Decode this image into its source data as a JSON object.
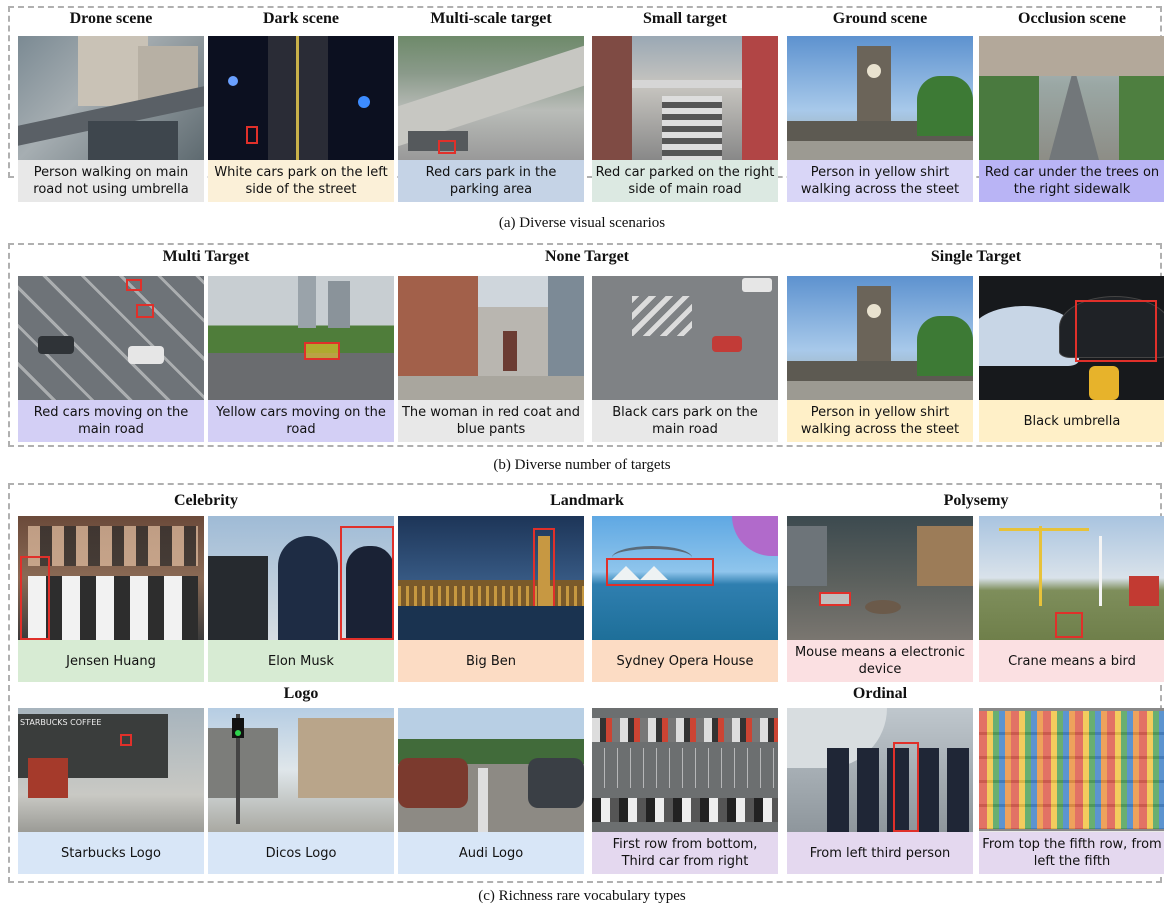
{
  "colors": {
    "gray": "#e8e8e8",
    "cream": "#fbf0d8",
    "steel": "#c5d3e6",
    "mint": "#dce9e2",
    "lavender": "#d9d6f7",
    "violet": "#b9b4f5",
    "lilac": "#d3cff5",
    "sand": "#fff0c8",
    "green": "#d7ebd3",
    "peach": "#fcdcc4",
    "pink": "#fbe0e2",
    "blue": "#d8e6f7",
    "purple": "#e4d8ef",
    "bbox": "#e0302a"
  },
  "sections": [
    {
      "caption": "(a) Diverse visual scenarios",
      "headings": [
        "Drone scene",
        "Dark scene",
        "Multi-scale target",
        "Small target",
        "Ground scene",
        "Occlusion scene"
      ],
      "cards": [
        {
          "label": "Person walking on main road not using umbrella",
          "scene": "aerial-city"
        },
        {
          "label": "White cars park on the left side of the street",
          "scene": "night-road"
        },
        {
          "label": "Red cars park in the parking area",
          "scene": "parking"
        },
        {
          "label": "Red car parked on the right side of main road",
          "scene": "busy-street"
        },
        {
          "label": "Person in yellow shirt walking across the steet",
          "scene": "clocktower"
        },
        {
          "label": "Red car under the trees on the right sidewalk",
          "scene": "avenue"
        }
      ]
    },
    {
      "caption": "(b) Diverse number of targets",
      "headings": [
        "Multi Target",
        "None Target",
        "Single Target"
      ],
      "cards": [
        {
          "label": "Red cars moving on the main road",
          "scene": "aerial-cars"
        },
        {
          "label": "Yellow cars moving on the road",
          "scene": "highway"
        },
        {
          "label": "The woman in red coat and blue pants",
          "scene": "brick-street"
        },
        {
          "label": "Black cars park on the main road",
          "scene": "crossing"
        },
        {
          "label": "Person in yellow shirt walking across the steet",
          "scene": "clocktower"
        },
        {
          "label": "Black umbrella",
          "scene": "umbrella"
        }
      ]
    },
    {
      "caption": "(c) Richness rare vocabulary types",
      "headings_row1": [
        "Celebrity",
        "Landmark",
        "Polysemy"
      ],
      "headings_row2": [
        "Logo",
        "Ordinal"
      ],
      "cards_row1": [
        {
          "label": "Jensen Huang",
          "scene": "crowd"
        },
        {
          "label": "Elon Musk",
          "scene": "suits"
        },
        {
          "label": "Big Ben",
          "scene": "parliament"
        },
        {
          "label": "Sydney Opera House",
          "scene": "opera"
        },
        {
          "label": "Mouse means a electronic device",
          "scene": "warehouse"
        },
        {
          "label": "Crane means a bird",
          "scene": "cranes"
        }
      ],
      "cards_row2": [
        {
          "label": "Starbucks Logo",
          "scene": "storefront"
        },
        {
          "label": "Dicos Logo",
          "scene": "plaza"
        },
        {
          "label": "Audi Logo",
          "scene": "carpark"
        },
        {
          "label": "First row from bottom, Third car from right",
          "scene": "lot-aerial"
        },
        {
          "label": "From left third person",
          "scene": "pilots"
        },
        {
          "label": "From top the fifth row, from left the fifth",
          "scene": "shelves"
        }
      ]
    }
  ],
  "logo_text": "STARBUCKS COFFEE"
}
